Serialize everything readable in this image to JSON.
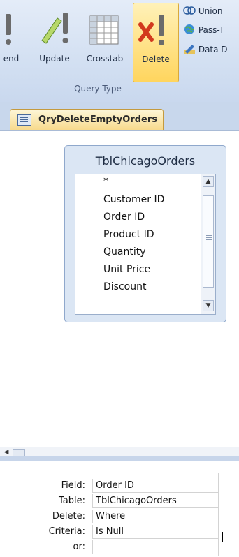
{
  "ribbon": {
    "buttons": [
      {
        "label": "end",
        "icon": "append-query-icon"
      },
      {
        "label": "Update",
        "icon": "update-query-icon"
      },
      {
        "label": "Crosstab",
        "icon": "crosstab-query-icon"
      },
      {
        "label": "Delete",
        "icon": "delete-query-icon",
        "active": true
      }
    ],
    "small_buttons": [
      {
        "label": "Union",
        "icon": "union-icon"
      },
      {
        "label": "Pass-T",
        "icon": "pass-through-icon"
      },
      {
        "label": "Data D",
        "icon": "data-definition-icon"
      }
    ],
    "group_label": "Query Type"
  },
  "document_tab": {
    "label": "QryDeleteEmptyOrders"
  },
  "table_box": {
    "title": "TblChicagoOrders",
    "fields": [
      "*",
      "Customer ID",
      "Order ID",
      "Product ID",
      "Quantity",
      "Unit Price",
      "Discount"
    ]
  },
  "grid": {
    "row_labels": [
      "Field:",
      "Table:",
      "Delete:",
      "Criteria:",
      "or:"
    ],
    "column1": [
      "Order ID",
      "TblChicagoOrders",
      "Where",
      "Is Null",
      ""
    ]
  },
  "colors": {
    "accent": "#ffd55e",
    "ribbon": "#d3e0f2",
    "tab": "#f7d98a"
  }
}
